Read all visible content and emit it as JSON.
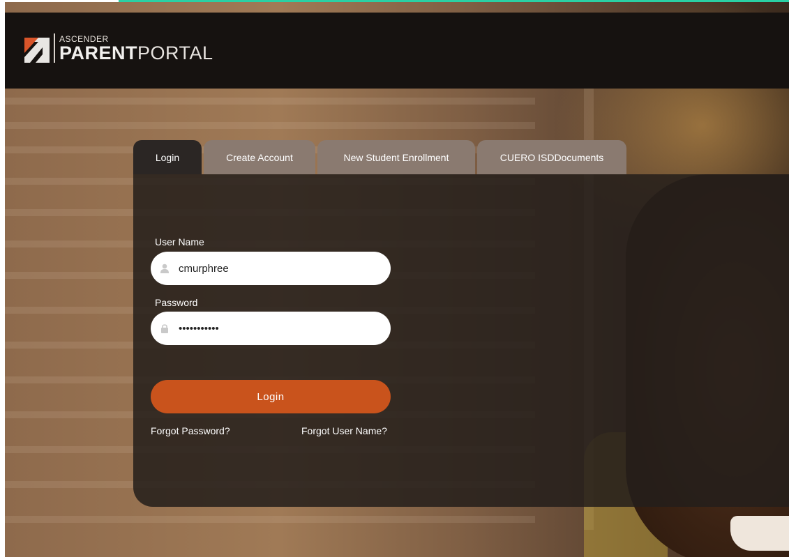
{
  "brand": {
    "small": "ASCENDER",
    "bold": "PARENT",
    "light": "PORTAL"
  },
  "tabs": [
    {
      "label": "Login",
      "active": true
    },
    {
      "label": "Create Account",
      "active": false
    },
    {
      "label": "New Student Enrollment",
      "active": false
    },
    {
      "label": "CUERO ISDDocuments",
      "active": false
    }
  ],
  "form": {
    "username_label": "User Name",
    "username_value": "cmurphree",
    "username_icon": "user-icon",
    "password_label": "Password",
    "password_value": "•••••••••••",
    "password_icon": "lock-icon",
    "login_button": "Login",
    "forgot_password": "Forgot Password?",
    "forgot_username": "Forgot User Name?"
  },
  "colors": {
    "accent_teal": "#2ad0a4",
    "login_orange": "#c9531c",
    "header_dark": "#161210"
  }
}
